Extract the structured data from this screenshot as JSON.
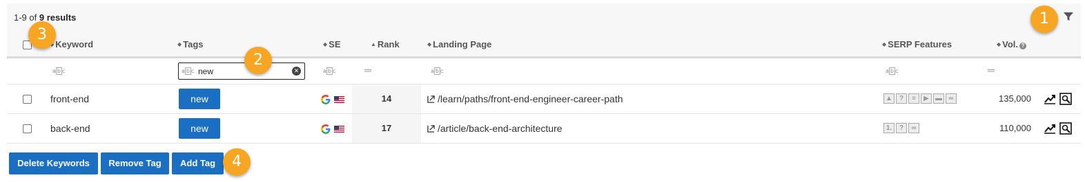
{
  "results": {
    "prefix": "1-9 of",
    "count": "9 results"
  },
  "columns": {
    "keyword": "Keyword",
    "tags": "Tags",
    "se": "SE",
    "rank": "Rank",
    "landing_page": "Landing Page",
    "serp_features": "SERP Features",
    "volume": "Vol."
  },
  "filters": {
    "tags_value": "new"
  },
  "rows": [
    {
      "keyword": "front-end",
      "tag": "new",
      "rank": "14",
      "landing_page": "/learn/paths/front-end-engineer-career-path",
      "volume": "135,000"
    },
    {
      "keyword": "back-end",
      "tag": "new",
      "rank": "17",
      "landing_page": "/article/back-end-architecture",
      "volume": "110,000"
    }
  ],
  "actions": {
    "delete": "Delete Keywords",
    "remove_tag": "Remove Tag",
    "add_tag": "Add Tag"
  },
  "badges": [
    "1",
    "2",
    "3",
    "4"
  ],
  "colors": {
    "accent_blue": "#1b6fc2",
    "badge_orange": "#f6a623"
  }
}
